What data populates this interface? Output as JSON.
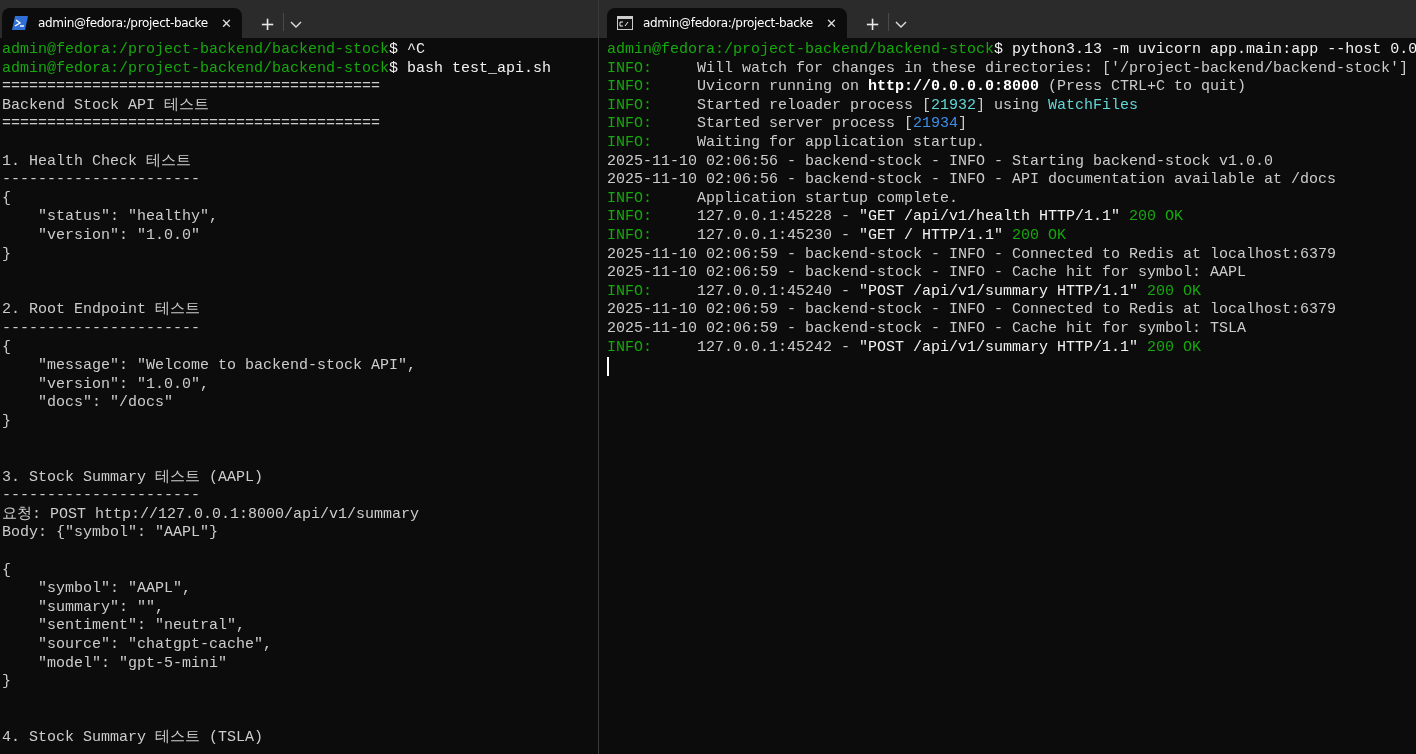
{
  "panes": [
    {
      "tab": {
        "title": "admin@fedora:/project-backe",
        "close": "✕",
        "new_tab": "+"
      },
      "lines": [
        {
          "kind": "text",
          "segments": [
            {
              "kind": "prompt",
              "text": "admin@fedora:/project-backend/backend-stock"
            },
            {
              "kind": "bright",
              "text": "$ ^C"
            }
          ]
        },
        {
          "kind": "text",
          "segments": [
            {
              "kind": "prompt",
              "text": "admin@fedora:/project-backend/backend-stock"
            },
            {
              "kind": "bright",
              "text": "$ bash test_api.sh"
            }
          ]
        },
        {
          "kind": "text",
          "segments": [
            {
              "kind": "plain",
              "text": "=========================================="
            }
          ]
        },
        {
          "kind": "text",
          "segments": [
            {
              "kind": "plain",
              "text": "Backend Stock API 테스트"
            }
          ]
        },
        {
          "kind": "text",
          "segments": [
            {
              "kind": "plain",
              "text": "=========================================="
            }
          ]
        },
        {
          "kind": "blank"
        },
        {
          "kind": "text",
          "segments": [
            {
              "kind": "plain",
              "text": "1. Health Check 테스트"
            }
          ]
        },
        {
          "kind": "text",
          "segments": [
            {
              "kind": "plain",
              "text": "----------------------"
            }
          ]
        },
        {
          "kind": "text",
          "segments": [
            {
              "kind": "plain",
              "text": "{"
            }
          ]
        },
        {
          "kind": "text",
          "segments": [
            {
              "kind": "plain",
              "text": "    \"status\": \"healthy\","
            }
          ]
        },
        {
          "kind": "text",
          "segments": [
            {
              "kind": "plain",
              "text": "    \"version\": \"1.0.0\""
            }
          ]
        },
        {
          "kind": "text",
          "segments": [
            {
              "kind": "plain",
              "text": "}"
            }
          ]
        },
        {
          "kind": "blank"
        },
        {
          "kind": "blank"
        },
        {
          "kind": "text",
          "segments": [
            {
              "kind": "plain",
              "text": "2. Root Endpoint 테스트"
            }
          ]
        },
        {
          "kind": "text",
          "segments": [
            {
              "kind": "plain",
              "text": "----------------------"
            }
          ]
        },
        {
          "kind": "text",
          "segments": [
            {
              "kind": "plain",
              "text": "{"
            }
          ]
        },
        {
          "kind": "text",
          "segments": [
            {
              "kind": "plain",
              "text": "    \"message\": \"Welcome to backend-stock API\","
            }
          ]
        },
        {
          "kind": "text",
          "segments": [
            {
              "kind": "plain",
              "text": "    \"version\": \"1.0.0\","
            }
          ]
        },
        {
          "kind": "text",
          "segments": [
            {
              "kind": "plain",
              "text": "    \"docs\": \"/docs\""
            }
          ]
        },
        {
          "kind": "text",
          "segments": [
            {
              "kind": "plain",
              "text": "}"
            }
          ]
        },
        {
          "kind": "blank"
        },
        {
          "kind": "blank"
        },
        {
          "kind": "text",
          "segments": [
            {
              "kind": "plain",
              "text": "3. Stock Summary 테스트 (AAPL)"
            }
          ]
        },
        {
          "kind": "text",
          "segments": [
            {
              "kind": "plain",
              "text": "----------------------"
            }
          ]
        },
        {
          "kind": "text",
          "segments": [
            {
              "kind": "plain",
              "text": "요청: POST http://127.0.0.1:8000/api/v1/summary"
            }
          ]
        },
        {
          "kind": "text",
          "segments": [
            {
              "kind": "plain",
              "text": "Body: {\"symbol\": \"AAPL\"}"
            }
          ]
        },
        {
          "kind": "blank"
        },
        {
          "kind": "text",
          "segments": [
            {
              "kind": "plain",
              "text": "{"
            }
          ]
        },
        {
          "kind": "text",
          "segments": [
            {
              "kind": "plain",
              "text": "    \"symbol\": \"AAPL\","
            }
          ]
        },
        {
          "kind": "text",
          "segments": [
            {
              "kind": "plain",
              "text": "    \"summary\": \"\","
            }
          ]
        },
        {
          "kind": "text",
          "segments": [
            {
              "kind": "plain",
              "text": "    \"sentiment\": \"neutral\","
            }
          ]
        },
        {
          "kind": "text",
          "segments": [
            {
              "kind": "plain",
              "text": "    \"source\": \"chatgpt-cache\","
            }
          ]
        },
        {
          "kind": "text",
          "segments": [
            {
              "kind": "plain",
              "text": "    \"model\": \"gpt-5-mini\""
            }
          ]
        },
        {
          "kind": "text",
          "segments": [
            {
              "kind": "plain",
              "text": "}"
            }
          ]
        },
        {
          "kind": "blank"
        },
        {
          "kind": "blank"
        },
        {
          "kind": "text",
          "segments": [
            {
              "kind": "plain",
              "text": "4. Stock Summary 테스트 (TSLA)"
            }
          ]
        }
      ]
    },
    {
      "tab": {
        "title": "admin@fedora:/project-backe",
        "close": "✕",
        "new_tab": "+"
      },
      "lines": [
        {
          "kind": "text",
          "segments": [
            {
              "kind": "prompt",
              "text": "admin@fedora:/project-backend/backend-stock"
            },
            {
              "kind": "bright",
              "text": "$ python3.13 -m uvicorn app.main:app --host 0.0"
            }
          ]
        },
        {
          "kind": "text",
          "segments": [
            {
              "kind": "level",
              "text": "INFO:"
            },
            {
              "kind": "plain",
              "text": "Will watch for changes in these directories: ['/project-backend/backend-stock']"
            }
          ]
        },
        {
          "kind": "text",
          "segments": [
            {
              "kind": "level",
              "text": "INFO:"
            },
            {
              "kind": "plain",
              "text": "Uvicorn running on "
            },
            {
              "kind": "strong",
              "text": "http://0.0.0.0:8000"
            },
            {
              "kind": "plain",
              "text": " (Press CTRL+C to quit)"
            }
          ]
        },
        {
          "kind": "text",
          "segments": [
            {
              "kind": "level",
              "text": "INFO:"
            },
            {
              "kind": "plain",
              "text": "Started reloader process ["
            },
            {
              "kind": "cyan",
              "text": "21932"
            },
            {
              "kind": "plain",
              "text": "] using "
            },
            {
              "kind": "cyan",
              "text": "WatchFiles"
            }
          ]
        },
        {
          "kind": "text",
          "segments": [
            {
              "kind": "level",
              "text": "INFO:"
            },
            {
              "kind": "plain",
              "text": "Started server process ["
            },
            {
              "kind": "blue",
              "text": "21934"
            },
            {
              "kind": "plain",
              "text": "]"
            }
          ]
        },
        {
          "kind": "text",
          "segments": [
            {
              "kind": "level",
              "text": "INFO:"
            },
            {
              "kind": "plain",
              "text": "Waiting for application startup."
            }
          ]
        },
        {
          "kind": "text",
          "segments": [
            {
              "kind": "plain",
              "text": "2025-11-10 02:06:56 - backend-stock - INFO - Starting backend-stock v1.0.0"
            }
          ]
        },
        {
          "kind": "text",
          "segments": [
            {
              "kind": "plain",
              "text": "2025-11-10 02:06:56 - backend-stock - INFO - API documentation available at /docs"
            }
          ]
        },
        {
          "kind": "text",
          "segments": [
            {
              "kind": "level",
              "text": "INFO:"
            },
            {
              "kind": "plain",
              "text": "Application startup complete."
            }
          ]
        },
        {
          "kind": "text",
          "segments": [
            {
              "kind": "level",
              "text": "INFO:"
            },
            {
              "kind": "plain",
              "text": "127.0.0.1:45228 - "
            },
            {
              "kind": "bright",
              "text": "\"GET /api/v1/health HTTP/1.1\""
            },
            {
              "kind": "ok",
              "text": " 200 OK"
            }
          ]
        },
        {
          "kind": "text",
          "segments": [
            {
              "kind": "level",
              "text": "INFO:"
            },
            {
              "kind": "plain",
              "text": "127.0.0.1:45230 - "
            },
            {
              "kind": "bright",
              "text": "\"GET / HTTP/1.1\""
            },
            {
              "kind": "ok",
              "text": " 200 OK"
            }
          ]
        },
        {
          "kind": "text",
          "segments": [
            {
              "kind": "plain",
              "text": "2025-11-10 02:06:59 - backend-stock - INFO - Connected to Redis at localhost:6379"
            }
          ]
        },
        {
          "kind": "text",
          "segments": [
            {
              "kind": "plain",
              "text": "2025-11-10 02:06:59 - backend-stock - INFO - Cache hit for symbol: AAPL"
            }
          ]
        },
        {
          "kind": "text",
          "segments": [
            {
              "kind": "level",
              "text": "INFO:"
            },
            {
              "kind": "plain",
              "text": "127.0.0.1:45240 - "
            },
            {
              "kind": "bright",
              "text": "\"POST /api/v1/summary HTTP/1.1\""
            },
            {
              "kind": "ok",
              "text": " 200 OK"
            }
          ]
        },
        {
          "kind": "text",
          "segments": [
            {
              "kind": "plain",
              "text": "2025-11-10 02:06:59 - backend-stock - INFO - Connected to Redis at localhost:6379"
            }
          ]
        },
        {
          "kind": "text",
          "segments": [
            {
              "kind": "plain",
              "text": "2025-11-10 02:06:59 - backend-stock - INFO - Cache hit for symbol: TSLA"
            }
          ]
        },
        {
          "kind": "text",
          "segments": [
            {
              "kind": "level",
              "text": "INFO:"
            },
            {
              "kind": "plain",
              "text": "127.0.0.1:45242 - "
            },
            {
              "kind": "bright",
              "text": "\"POST /api/v1/summary HTTP/1.1\""
            },
            {
              "kind": "ok",
              "text": " 200 OK"
            }
          ]
        }
      ],
      "cursor": true
    }
  ]
}
